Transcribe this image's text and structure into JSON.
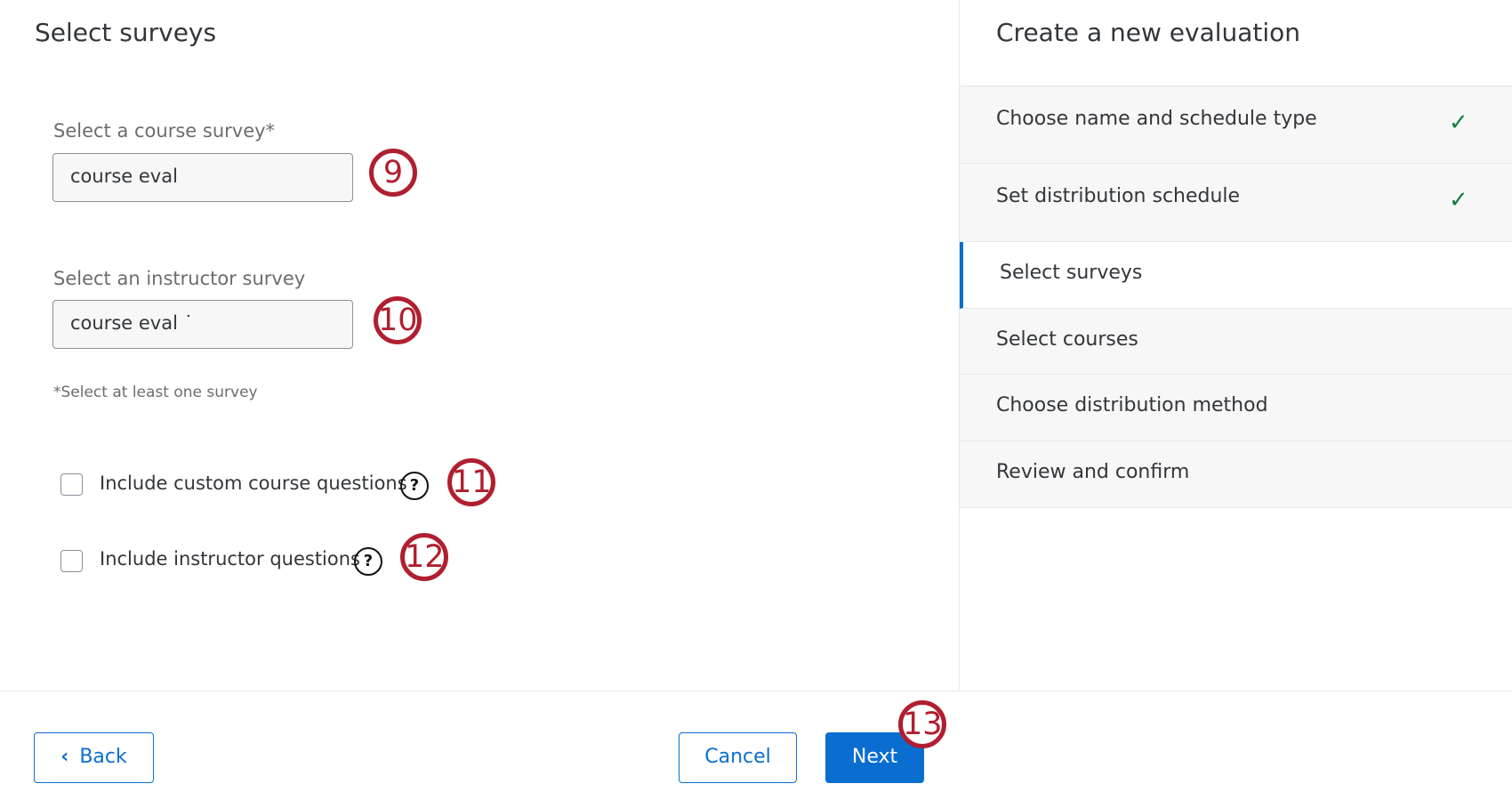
{
  "main": {
    "title": "Select surveys",
    "course_survey": {
      "label": "Select a course survey*",
      "value": "course eval"
    },
    "instructor_survey": {
      "label": "Select an instructor survey",
      "value": "course eval ˙"
    },
    "hint": "*Select at least one survey",
    "options": [
      {
        "label": "Include custom course questions",
        "checked": false,
        "icon": "help-icon"
      },
      {
        "label": "Include instructor questions",
        "checked": false,
        "icon": "help-icon"
      }
    ],
    "help_glyph": "?"
  },
  "callouts": [
    "9",
    "10",
    "11",
    "12",
    "13"
  ],
  "footer": {
    "back_label": "Back",
    "back_icon": "chevron-left-icon",
    "cancel_label": "Cancel",
    "next_label": "Next"
  },
  "sidebar": {
    "title": "Create a new evaluation",
    "steps": [
      {
        "label": "Choose name and schedule type",
        "state": "done"
      },
      {
        "label": "Set distribution schedule",
        "state": "done"
      },
      {
        "label": "Select surveys",
        "state": "active"
      },
      {
        "label": "Select courses",
        "state": "todo"
      },
      {
        "label": "Choose distribution method",
        "state": "todo"
      },
      {
        "label": "Review and confirm",
        "state": "todo"
      }
    ]
  },
  "colors": {
    "accent": "#0a6ed1",
    "callout": "#b01f2f",
    "success": "#107e3e"
  }
}
